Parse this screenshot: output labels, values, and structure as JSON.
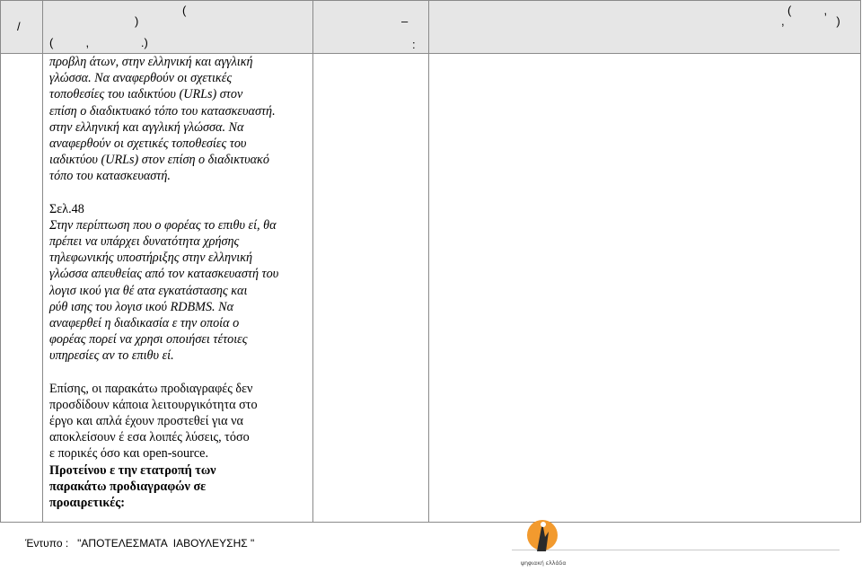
{
  "header": {
    "col1_line1": "/",
    "col2_line1": "(",
    "col2_line2": ")",
    "col2_line3": "(          ,                .)",
    "col3_line1": "–",
    "col3_line2": ":",
    "col4_line1": "(          ,",
    "col4_line2": ",                )"
  },
  "body": {
    "para1": [
      "προβλη  άτων, στην ελληνική και αγγλική",
      "γλώσσα. Να αναφερθούν οι σχετικές",
      "τοποθεσίες του  ιαδικτύου (URLs) στον",
      "επίση  ο διαδικτυακό τόπο του κατασκευαστή.",
      "στην ελληνική και αγγλική γλώσσα. Να",
      "αναφερθούν οι σχετικές τοποθεσίες του",
      " ιαδικτύου (URLs) στον επίση  ο διαδικτυακό",
      "τόπο του κατασκευαστή."
    ],
    "page_ref": "Σελ.48",
    "para2": [
      "Στην περίπτωση που ο φορέας το επιθυ  εί, θα",
      "πρέπει να υπάρχει δυνατότητα χρήσης",
      "τηλεφωνικής υποστήριξης στην ελληνική",
      "γλώσσα απευθείας από τον κατασκευαστή του",
      "λογισ  ικού για θέ  ατα εγκατάστασης και",
      "ρύθ  ισης του λογισ  ικού RDBMS. Να",
      "αναφερθεί η διαδικασία  ε την οποία ο",
      "φορέας   πορεί να χρησι  οποιήσει τέτοιες",
      "υπηρεσίες αν το επιθυ  εί."
    ],
    "para3": [
      "Επίσης, οι παρακάτω προδιαγραφές δεν",
      "προσδίδουν κάποια λειτουργικότητα στο",
      "έργο και απλά έχουν προστεθεί για να",
      "αποκλείσουν έ    εσα λοιπές λύσεις, τόσο",
      "ε  πορικές όσο και open-source."
    ],
    "para4": [
      "Προτείνου  ε την  ετατροπή των",
      "παρακάτω προδιαγραφών σε",
      "προαιρετικές:"
    ]
  },
  "footer": {
    "form_text": "Έντυπο :   \"ΑΠΟΤΕΛΕΣΜΑΤΑ  ΙΑΒΟΥΛΕΥΣΗΣ \"",
    "logo_text": "ψηφιακή ελλάδα"
  },
  "colors": {
    "header_shade": "#e6e6e6",
    "grid": "#8a8a8a",
    "logo_orange": "#f29a2e"
  }
}
